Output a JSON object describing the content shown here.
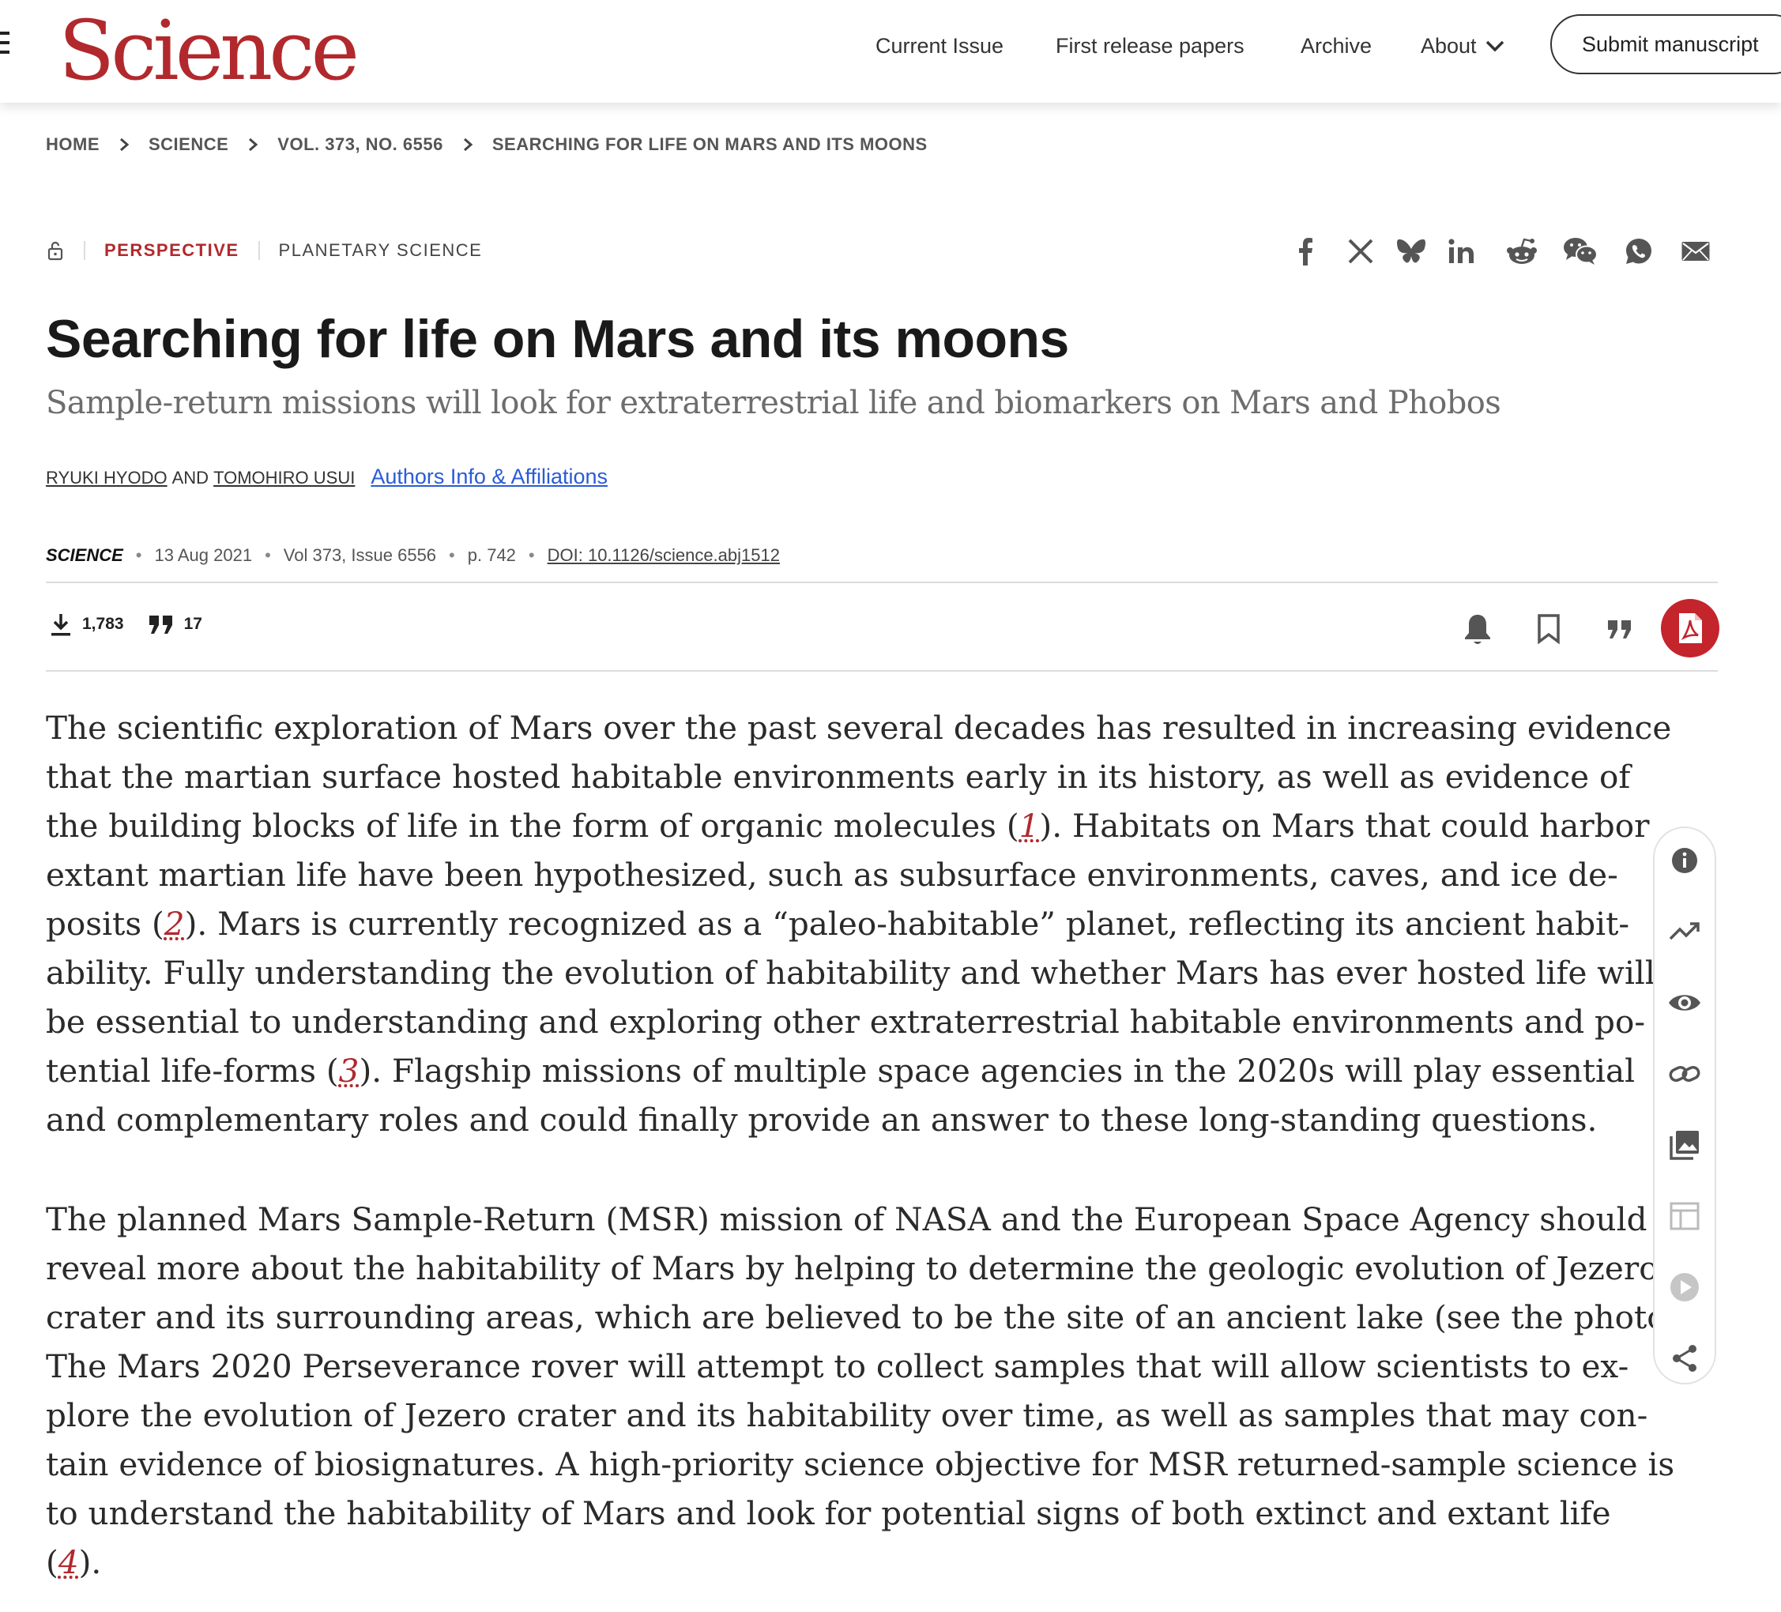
{
  "header": {
    "logo": "Science",
    "nav": {
      "current_issue": "Current Issue",
      "first_release": "First release papers",
      "archive": "Archive",
      "about": "About"
    },
    "submit_label": "Submit manuscript"
  },
  "breadcrumb": [
    "HOME",
    "SCIENCE",
    "VOL. 373, NO. 6556",
    "SEARCHING FOR LIFE ON MARS AND ITS MOONS"
  ],
  "article": {
    "type": "PERSPECTIVE",
    "subject": "PLANETARY SCIENCE",
    "title": "Searching for life on Mars and its moons",
    "subtitle": "Sample-return missions will look for extraterrestrial life and biomarkers on Mars and Phobos",
    "authors": [
      "RYUKI HYODO",
      "TOMOHIRO USUI"
    ],
    "author_join": "AND",
    "affiliations_link": "Authors Info & Affiliations",
    "journal": "SCIENCE",
    "date": "13 Aug 2021",
    "volume": "Vol 373, Issue 6556",
    "page": "p. 742",
    "doi": "DOI: 10.1126/science.abj1512"
  },
  "metrics": {
    "downloads": "1,783",
    "citations": "17"
  },
  "share_icons": [
    "facebook-icon",
    "x-icon",
    "bluesky-icon",
    "linkedin-icon",
    "reddit-icon",
    "wechat-icon",
    "whatsapp-icon",
    "email-icon"
  ],
  "tool_icons": [
    "bell-icon",
    "bookmark-icon",
    "quote-icon",
    "pdf-icon"
  ],
  "side_rail_icons": [
    "info-icon",
    "trending-icon",
    "eye-icon",
    "link-icon",
    "image-icon",
    "table-icon",
    "play-icon",
    "share-icon"
  ],
  "colors": {
    "brand_red": "#b1292d",
    "link_blue": "#2a5bd7",
    "pdf_red": "#c4242b"
  },
  "body": {
    "p1": [
      [
        "The scientific exploration of Mars over the past several decades has resulted in increasing evidence"
      ],
      [
        "that the martian surface hosted habitable environments early in its history, as well as evidence of"
      ],
      [
        "the building blocks of life in the form of organic molecules (",
        {
          "ref": "1"
        },
        "). Habitats on Mars that could harbor"
      ],
      [
        "extant martian life have been hypothesized, such as subsurface environments, caves, and ice de-"
      ],
      [
        "posits (",
        {
          "ref": "2"
        },
        "). Mars is currently recognized as a “paleo-habitable” planet, reflecting its ancient habit-"
      ],
      [
        "ability. Fully understanding the evolution of habitability and whether Mars has ever hosted life will"
      ],
      [
        "be essential to understanding and exploring other extraterrestrial habitable environments and po-"
      ],
      [
        "tential life-forms (",
        {
          "ref": "3"
        },
        "). Flagship missions of multiple space agencies in the 2020s will play essential"
      ],
      [
        "and complementary roles and could finally provide an answer to these long-standing questions."
      ]
    ],
    "p2": [
      [
        "The planned Mars Sample-Return (MSR) mission of NASA and the European Space Agency should"
      ],
      [
        "reveal more about the habitability of Mars by helping to determine the geologic evolution of Jezero"
      ],
      [
        "crater and its surrounding areas, which are believed to be the site of an ancient lake (see the photo)."
      ],
      [
        "The Mars 2020 Perseverance rover will attempt to collect samples that will allow scientists to ex-"
      ],
      [
        "plore the evolution of Jezero crater and its habitability over time, as well as samples that may con-"
      ],
      [
        "tain evidence of biosignatures. A high-priority science objective for MSR returned-sample science is"
      ],
      [
        "to understand the habitability of Mars and look for potential signs of both extinct and extant life"
      ],
      [
        "(",
        {
          "ref": "4"
        },
        ")."
      ]
    ]
  }
}
